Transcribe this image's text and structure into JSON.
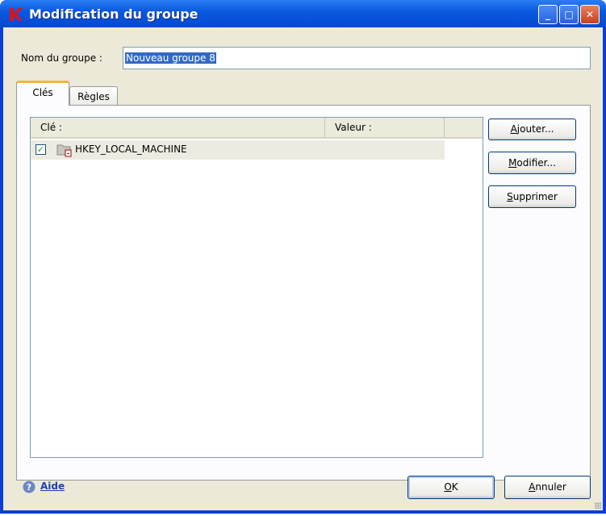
{
  "window": {
    "title": "Modification du groupe"
  },
  "form": {
    "group_name_label": "Nom du groupe :",
    "group_name_value": "Nouveau groupe 8"
  },
  "tabs": [
    {
      "label": "Clés",
      "selected": true
    },
    {
      "label": "Règles",
      "selected": false
    }
  ],
  "list": {
    "columns": [
      "Clé :",
      "Valeur :"
    ],
    "rows": [
      {
        "checked": true,
        "icon": "registry-folder-icon",
        "key": "HKEY_LOCAL_MACHINE",
        "value": ""
      }
    ]
  },
  "side_buttons": {
    "add_first": "A",
    "add_rest": "jouter...",
    "modify_first": "M",
    "modify_rest": "odifier...",
    "delete_first": "S",
    "delete_rest": "upprimer"
  },
  "footer": {
    "help": "Aide",
    "ok_first": "O",
    "ok_rest": "K",
    "cancel_first": "A",
    "cancel_rest": "nnuler"
  }
}
